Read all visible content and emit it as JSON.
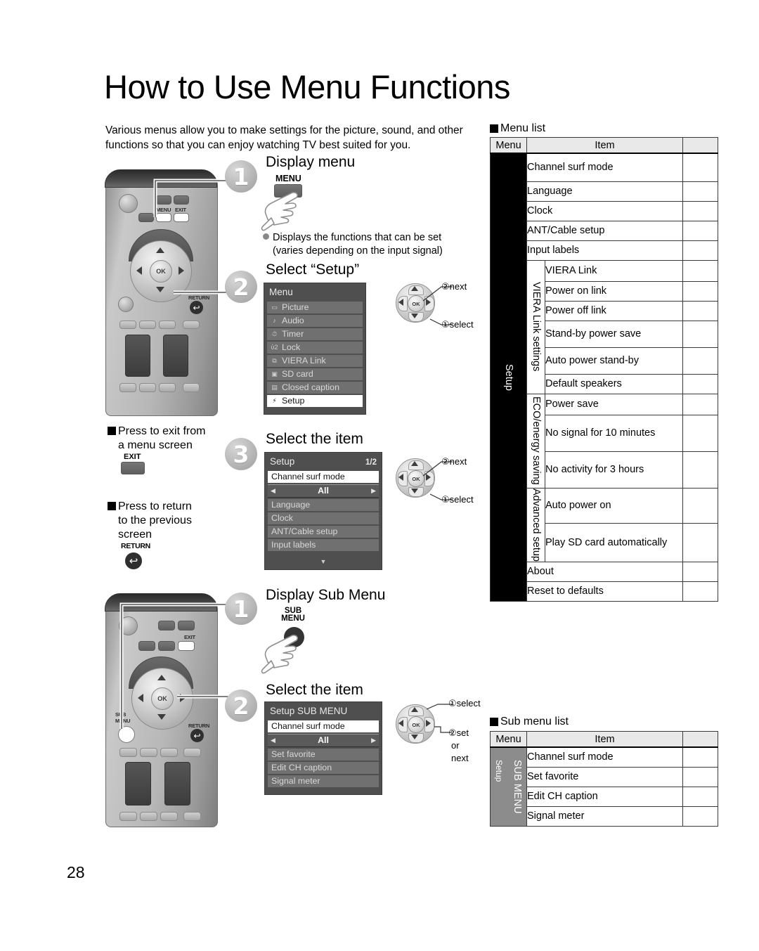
{
  "page": {
    "title": "How to Use Menu Functions",
    "intro": "Various menus allow you to make settings for the picture, sound, and other functions so that you can enjoy watching TV best suited for you.",
    "number": "28"
  },
  "steps": {
    "display_menu": {
      "num": "1",
      "heading": "Display menu",
      "button_label": "MENU",
      "note_line1": "Displays the functions that can be set",
      "note_line2": "(varies depending on the input signal)"
    },
    "select_setup": {
      "num": "2",
      "heading": "Select “Setup”",
      "dpad": {
        "next": "②next",
        "select": "①select"
      }
    },
    "select_item": {
      "num": "3",
      "heading": "Select the item",
      "dpad": {
        "next": "②next",
        "select": "①select"
      }
    },
    "display_sub_menu": {
      "num": "1",
      "heading": "Display Sub Menu",
      "button_label_line1": "SUB",
      "button_label_line2": "MENU"
    },
    "select_item_sub": {
      "num": "2",
      "heading": "Select the item",
      "dpad": {
        "select": "①select",
        "set": "②set",
        "or": "or",
        "next": "next"
      }
    }
  },
  "tips": {
    "exit": {
      "line1": "Press to exit from",
      "line2": "a menu screen",
      "key": "EXIT"
    },
    "return": {
      "line1": "Press to return",
      "line2": "to the previous",
      "line3": "screen",
      "key": "RETURN",
      "glyph": "↩"
    }
  },
  "osd_menu": {
    "title": "Menu",
    "items": [
      {
        "icon": "picture-icon",
        "glyph": "▭",
        "label": "Picture",
        "selected": false
      },
      {
        "icon": "audio-icon",
        "glyph": "♪",
        "label": "Audio",
        "selected": false
      },
      {
        "icon": "timer-icon",
        "glyph": "⏱",
        "label": "Timer",
        "selected": false
      },
      {
        "icon": "lock-icon",
        "glyph": "ὑ2",
        "label": "Lock",
        "selected": false
      },
      {
        "icon": "viera-link-icon",
        "glyph": "⧉",
        "label": "VIERA Link",
        "selected": false
      },
      {
        "icon": "sd-card-icon",
        "glyph": "▣",
        "label": "SD card",
        "selected": false
      },
      {
        "icon": "closed-caption-icon",
        "glyph": "▤",
        "label": "Closed caption",
        "selected": false
      },
      {
        "icon": "setup-icon",
        "glyph": "⚡",
        "label": "Setup",
        "selected": true
      }
    ]
  },
  "osd_setup": {
    "title": "Setup",
    "page_indicator": "1/2",
    "rows": [
      {
        "type": "selected",
        "label": "Channel surf mode"
      },
      {
        "type": "value",
        "label": "All",
        "left_arrow": "◀",
        "right_arrow": "▶"
      },
      {
        "type": "normal",
        "label": "Language"
      },
      {
        "type": "normal",
        "label": "Clock"
      },
      {
        "type": "normal",
        "label": "ANT/Cable setup"
      },
      {
        "type": "normal",
        "label": "Input labels"
      }
    ],
    "scroll_glyph": "▼"
  },
  "osd_sub_menu": {
    "title": "Setup SUB MENU",
    "rows": [
      {
        "type": "selected",
        "label": "Channel surf mode"
      },
      {
        "type": "value",
        "label": "All",
        "left_arrow": "◀",
        "right_arrow": "▶"
      },
      {
        "type": "normal",
        "label": "Set favorite"
      },
      {
        "type": "normal",
        "label": "Edit CH caption"
      },
      {
        "type": "normal",
        "label": "Signal meter"
      }
    ]
  },
  "remote": {
    "labels": {
      "menu": "MENU",
      "exit": "EXIT",
      "return": "RETURN",
      "ok": "OK",
      "sub": "SUB",
      "sub_menu": "MENU"
    }
  },
  "menu_list": {
    "heading": "Menu list",
    "columns": {
      "menu": "Menu",
      "item": "Item"
    },
    "menu_label": "Setup",
    "groups": [
      {
        "group": null,
        "items": [
          "Channel surf mode",
          "Language",
          "Clock",
          "ANT/Cable setup",
          "Input labels"
        ]
      },
      {
        "group": "VIERA Link settings",
        "items": [
          "VIERA Link",
          "Power on link",
          "Power off link",
          "Stand-by power save",
          "Auto power stand-by",
          "Default speakers"
        ]
      },
      {
        "group": "ECO/energy saving",
        "items": [
          "Power save",
          "No signal for 10 minutes",
          "No activity for 3 hours"
        ]
      },
      {
        "group": "Advanced setup",
        "items": [
          "Auto power on",
          "Play SD card automatically"
        ]
      },
      {
        "group": null,
        "items": [
          "About",
          "Reset to defaults"
        ]
      }
    ]
  },
  "sub_menu_list": {
    "heading": "Sub menu list",
    "columns": {
      "menu": "Menu",
      "item": "Item"
    },
    "menu_label_outer": "SUB MENU",
    "menu_label_inner": "Setup",
    "items": [
      "Channel surf mode",
      "Set favorite",
      "Edit CH caption",
      "Signal meter"
    ]
  }
}
